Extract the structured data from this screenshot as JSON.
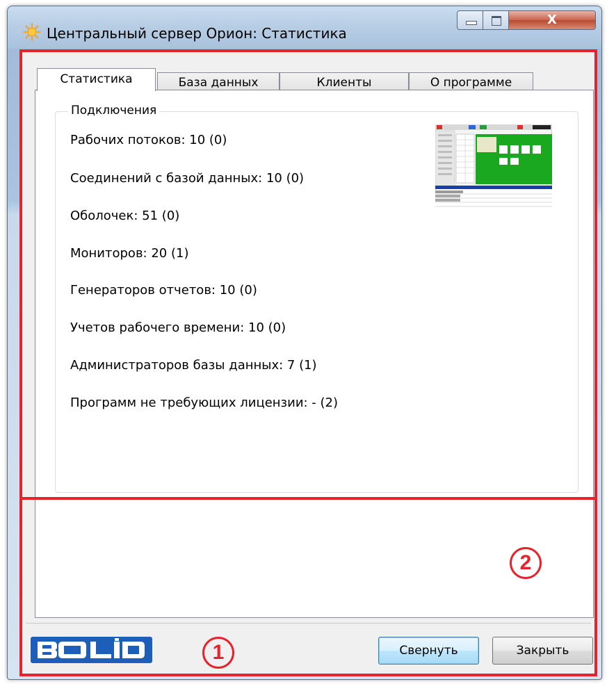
{
  "window": {
    "title": "Центральный сервер Орион: Статистика",
    "close_glyph": "X"
  },
  "tabs": [
    {
      "label": "Статистика",
      "active": true
    },
    {
      "label": "База данных",
      "active": false
    },
    {
      "label": "Клиенты",
      "active": false
    },
    {
      "label": "О программе",
      "active": false
    }
  ],
  "connections": {
    "legend": "Подключения",
    "lines": [
      "Рабочих потоков: 10 (0)",
      "Соединений с базой данных: 10 (0)",
      "Оболочек: 51 (0)",
      "Мониторов: 20 (1)",
      "Генераторов отчетов: 10 (0)",
      "Учетов рабочего времени: 10 (0)",
      "Администраторов базы данных: 7 (1)",
      "Программ не требующих лицензии: - (2)"
    ]
  },
  "footer": {
    "logo_text": "BOLID",
    "minimize_label": "Свернуть",
    "close_label": "Закрыть"
  },
  "annotations": {
    "callout_1": "1",
    "callout_2": "2"
  },
  "colors": {
    "annotation_red": "#e8222a",
    "logo_blue": "#1d5fb8",
    "thumb_green": "#19a81f"
  },
  "icons": {
    "app": "sun-icon",
    "minimize": "minimize-icon",
    "maximize": "maximize-icon",
    "close": "close-icon"
  }
}
